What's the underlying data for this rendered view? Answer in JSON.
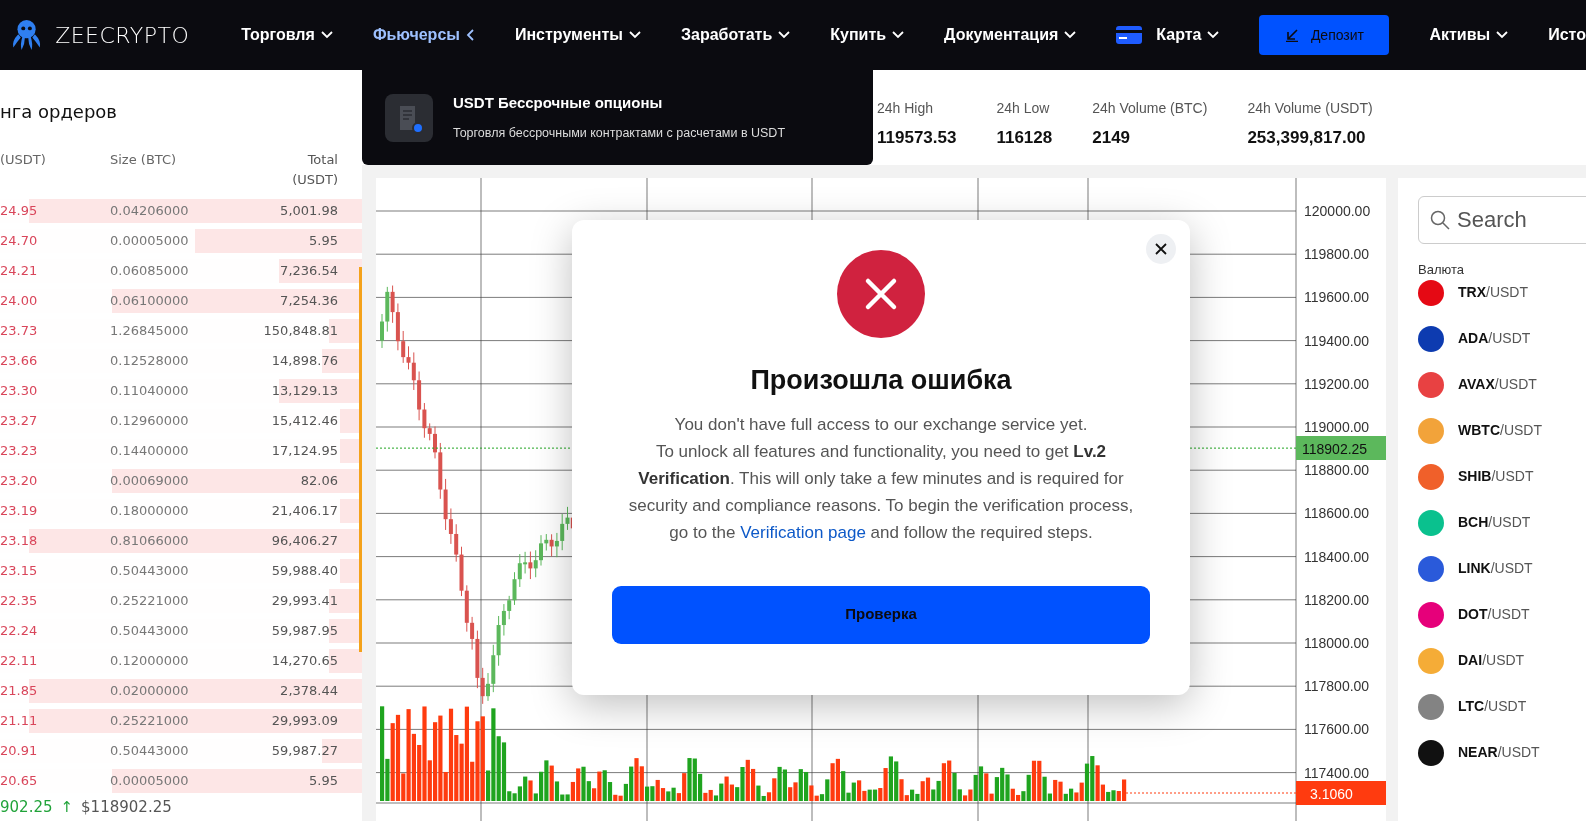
{
  "header": {
    "brand": "ZEECRYPTO",
    "nav": [
      {
        "label": "Торговля",
        "kind": "menu",
        "selected": false
      },
      {
        "label": "Фьючерсы",
        "kind": "menu_open",
        "selected": true
      },
      {
        "label": "Инструменты",
        "kind": "menu",
        "selected": false
      },
      {
        "label": "Заработать",
        "kind": "menu",
        "selected": false
      },
      {
        "label": "Купить",
        "kind": "menu",
        "selected": false
      },
      {
        "label": "Документация",
        "kind": "menu",
        "selected": false
      },
      {
        "label": "Карта",
        "kind": "card",
        "selected": false
      },
      {
        "label": "Депозит",
        "kind": "button",
        "selected": false
      },
      {
        "label": "Активы",
        "kind": "menu",
        "selected": false
      },
      {
        "label": "Исто",
        "kind": "link",
        "selected": false
      }
    ]
  },
  "futures_menu": {
    "title": "USDT Бессрочные опционы",
    "subtitle": "Торговля бессрочными контрактами с расчетами в USDT"
  },
  "order_book": {
    "title": "нга ордеров",
    "columns": [
      "(USDT)",
      "Size (BTC)",
      "Total (USDT)"
    ],
    "rows": [
      {
        "price": "24.95",
        "size": "0.04206000",
        "total": "5,001.98",
        "level": 0.92
      },
      {
        "price": "24.70",
        "size": "0.00005000",
        "total": "5.95",
        "level": 0.46
      },
      {
        "price": "24.21",
        "size": "0.06085000",
        "total": "7,236.54",
        "level": 0.23
      },
      {
        "price": "24.00",
        "size": "0.06100000",
        "total": "7,254.36",
        "level": 0.69
      },
      {
        "price": "23.73",
        "size": "1.26845000",
        "total": "150,848.81",
        "level": 0.09
      },
      {
        "price": "23.66",
        "size": "0.12528000",
        "total": "14,898.76",
        "level": 0.11
      },
      {
        "price": "23.30",
        "size": "0.11040000",
        "total": "13,129.13",
        "level": 0.23
      },
      {
        "price": "23.27",
        "size": "0.12960000",
        "total": "15,412.46",
        "level": 0.06
      },
      {
        "price": "23.23",
        "size": "0.14400000",
        "total": "17,124.95",
        "level": 0.06
      },
      {
        "price": "23.20",
        "size": "0.00069000",
        "total": "82.06",
        "level": 0.69
      },
      {
        "price": "23.19",
        "size": "0.18000000",
        "total": "21,406.17",
        "level": 0.06
      },
      {
        "price": "23.18",
        "size": "0.81066000",
        "total": "96,406.27",
        "level": 0.92
      },
      {
        "price": "23.15",
        "size": "0.50443000",
        "total": "59,988.40",
        "level": 0.06
      },
      {
        "price": "22.35",
        "size": "0.25221000",
        "total": "29,993.41",
        "level": 0.09
      },
      {
        "price": "22.24",
        "size": "0.50443000",
        "total": "59,987.95",
        "level": 0.09
      },
      {
        "price": "22.11",
        "size": "0.12000000",
        "total": "14,270.65",
        "level": 0.09
      },
      {
        "price": "21.85",
        "size": "0.02000000",
        "total": "2,378.44",
        "level": 0.92
      },
      {
        "price": "21.11",
        "size": "0.25221000",
        "total": "29,993.09",
        "level": 0.92
      },
      {
        "price": "20.91",
        "size": "0.50443000",
        "total": "59,987.27",
        "level": 0.11
      },
      {
        "price": "20.65",
        "size": "0.00005000",
        "total": "5.95",
        "level": 0.69
      }
    ],
    "last_price": {
      "value": "902.25",
      "arrow": "↑",
      "usd": "$118902.25"
    }
  },
  "stats": [
    {
      "label": "24h High",
      "value": "119573.53"
    },
    {
      "label": "24h Low",
      "value": "116128"
    },
    {
      "label": "24h Volume (BTC)",
      "value": "2149"
    },
    {
      "label": "24h Volume (USDT)",
      "value": "253,399,817.00"
    }
  ],
  "chart": {
    "price_axis": [
      "120000.00",
      "119800.00",
      "119600.00",
      "119400.00",
      "119200.00",
      "119000.00",
      "118800.00",
      "118600.00",
      "118400.00",
      "118200.00",
      "118000.00",
      "117800.00",
      "117600.00",
      "117400.00"
    ],
    "last_price_tag": "118902.25",
    "volume_tag": "3.1060"
  },
  "markets": {
    "search": {
      "placeholder": "Search"
    },
    "section_label": "Валюта",
    "pairs": [
      {
        "label": "**TRX**/USDT",
        "color": "#e50914"
      },
      {
        "label": "**ADA**/USDT",
        "color": "#0d3bb0"
      },
      {
        "label": "**AVAX**/USDT",
        "color": "#e84142"
      },
      {
        "label": "**WBTC**/USDT",
        "color": "#f2a33a"
      },
      {
        "label": "**SHIB**/USDT",
        "color": "#f0602a"
      },
      {
        "label": "**BCH**/USDT",
        "color": "#0ac18e"
      },
      {
        "label": "**LINK**/USDT",
        "color": "#2a5ada"
      },
      {
        "label": "**DOT**/USDT",
        "color": "#e6007a"
      },
      {
        "label": "**DAI**/USDT",
        "color": "#f5ac37"
      },
      {
        "label": "**LTC**/USDT",
        "color": "#838383"
      },
      {
        "label": "**NEAR**/USDT",
        "color": "#111111"
      }
    ]
  },
  "modal": {
    "title": "Произошла ошибка",
    "intro": "You don't have full access to our exchange service yet.",
    "body": "To unlock all features and functionality, you need to get **Lv.2 Verification**. This will only take a few minutes and is required for security and compliance reasons. To begin the verification process, go to the",
    "link": "Verification page",
    "outro": "and follow the required steps.",
    "button": "Проверка"
  }
}
